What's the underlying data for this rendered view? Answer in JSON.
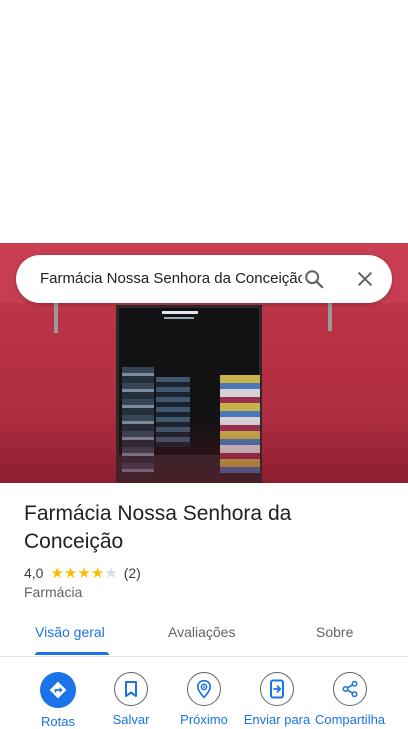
{
  "search": {
    "query": "Farmácia Nossa Senhora da Conceição",
    "search_icon": "search-icon",
    "close_icon": "close-icon"
  },
  "place": {
    "name": "Farmácia Nossa Senhora da Conceição",
    "rating": "4,0",
    "rating_value": 4,
    "rating_max": 5,
    "review_count": "(2)",
    "category": "Farmácia"
  },
  "tabs": [
    {
      "label": "Visão geral",
      "active": true
    },
    {
      "label": "Avaliações",
      "active": false
    },
    {
      "label": "Sobre",
      "active": false
    }
  ],
  "actions": [
    {
      "label": "Rotas",
      "icon": "directions-icon"
    },
    {
      "label": "Salvar",
      "icon": "bookmark-icon"
    },
    {
      "label": "Próximo",
      "icon": "nearby-icon"
    },
    {
      "label": "Enviar para",
      "icon": "send-to-phone-icon"
    },
    {
      "label": "Compartilha",
      "icon": "share-icon"
    }
  ],
  "colors": {
    "accent": "#1a73e8",
    "star_filled": "#fbbc04",
    "star_empty": "#dadce0",
    "text_primary": "#202124",
    "text_secondary": "#5f6368"
  }
}
